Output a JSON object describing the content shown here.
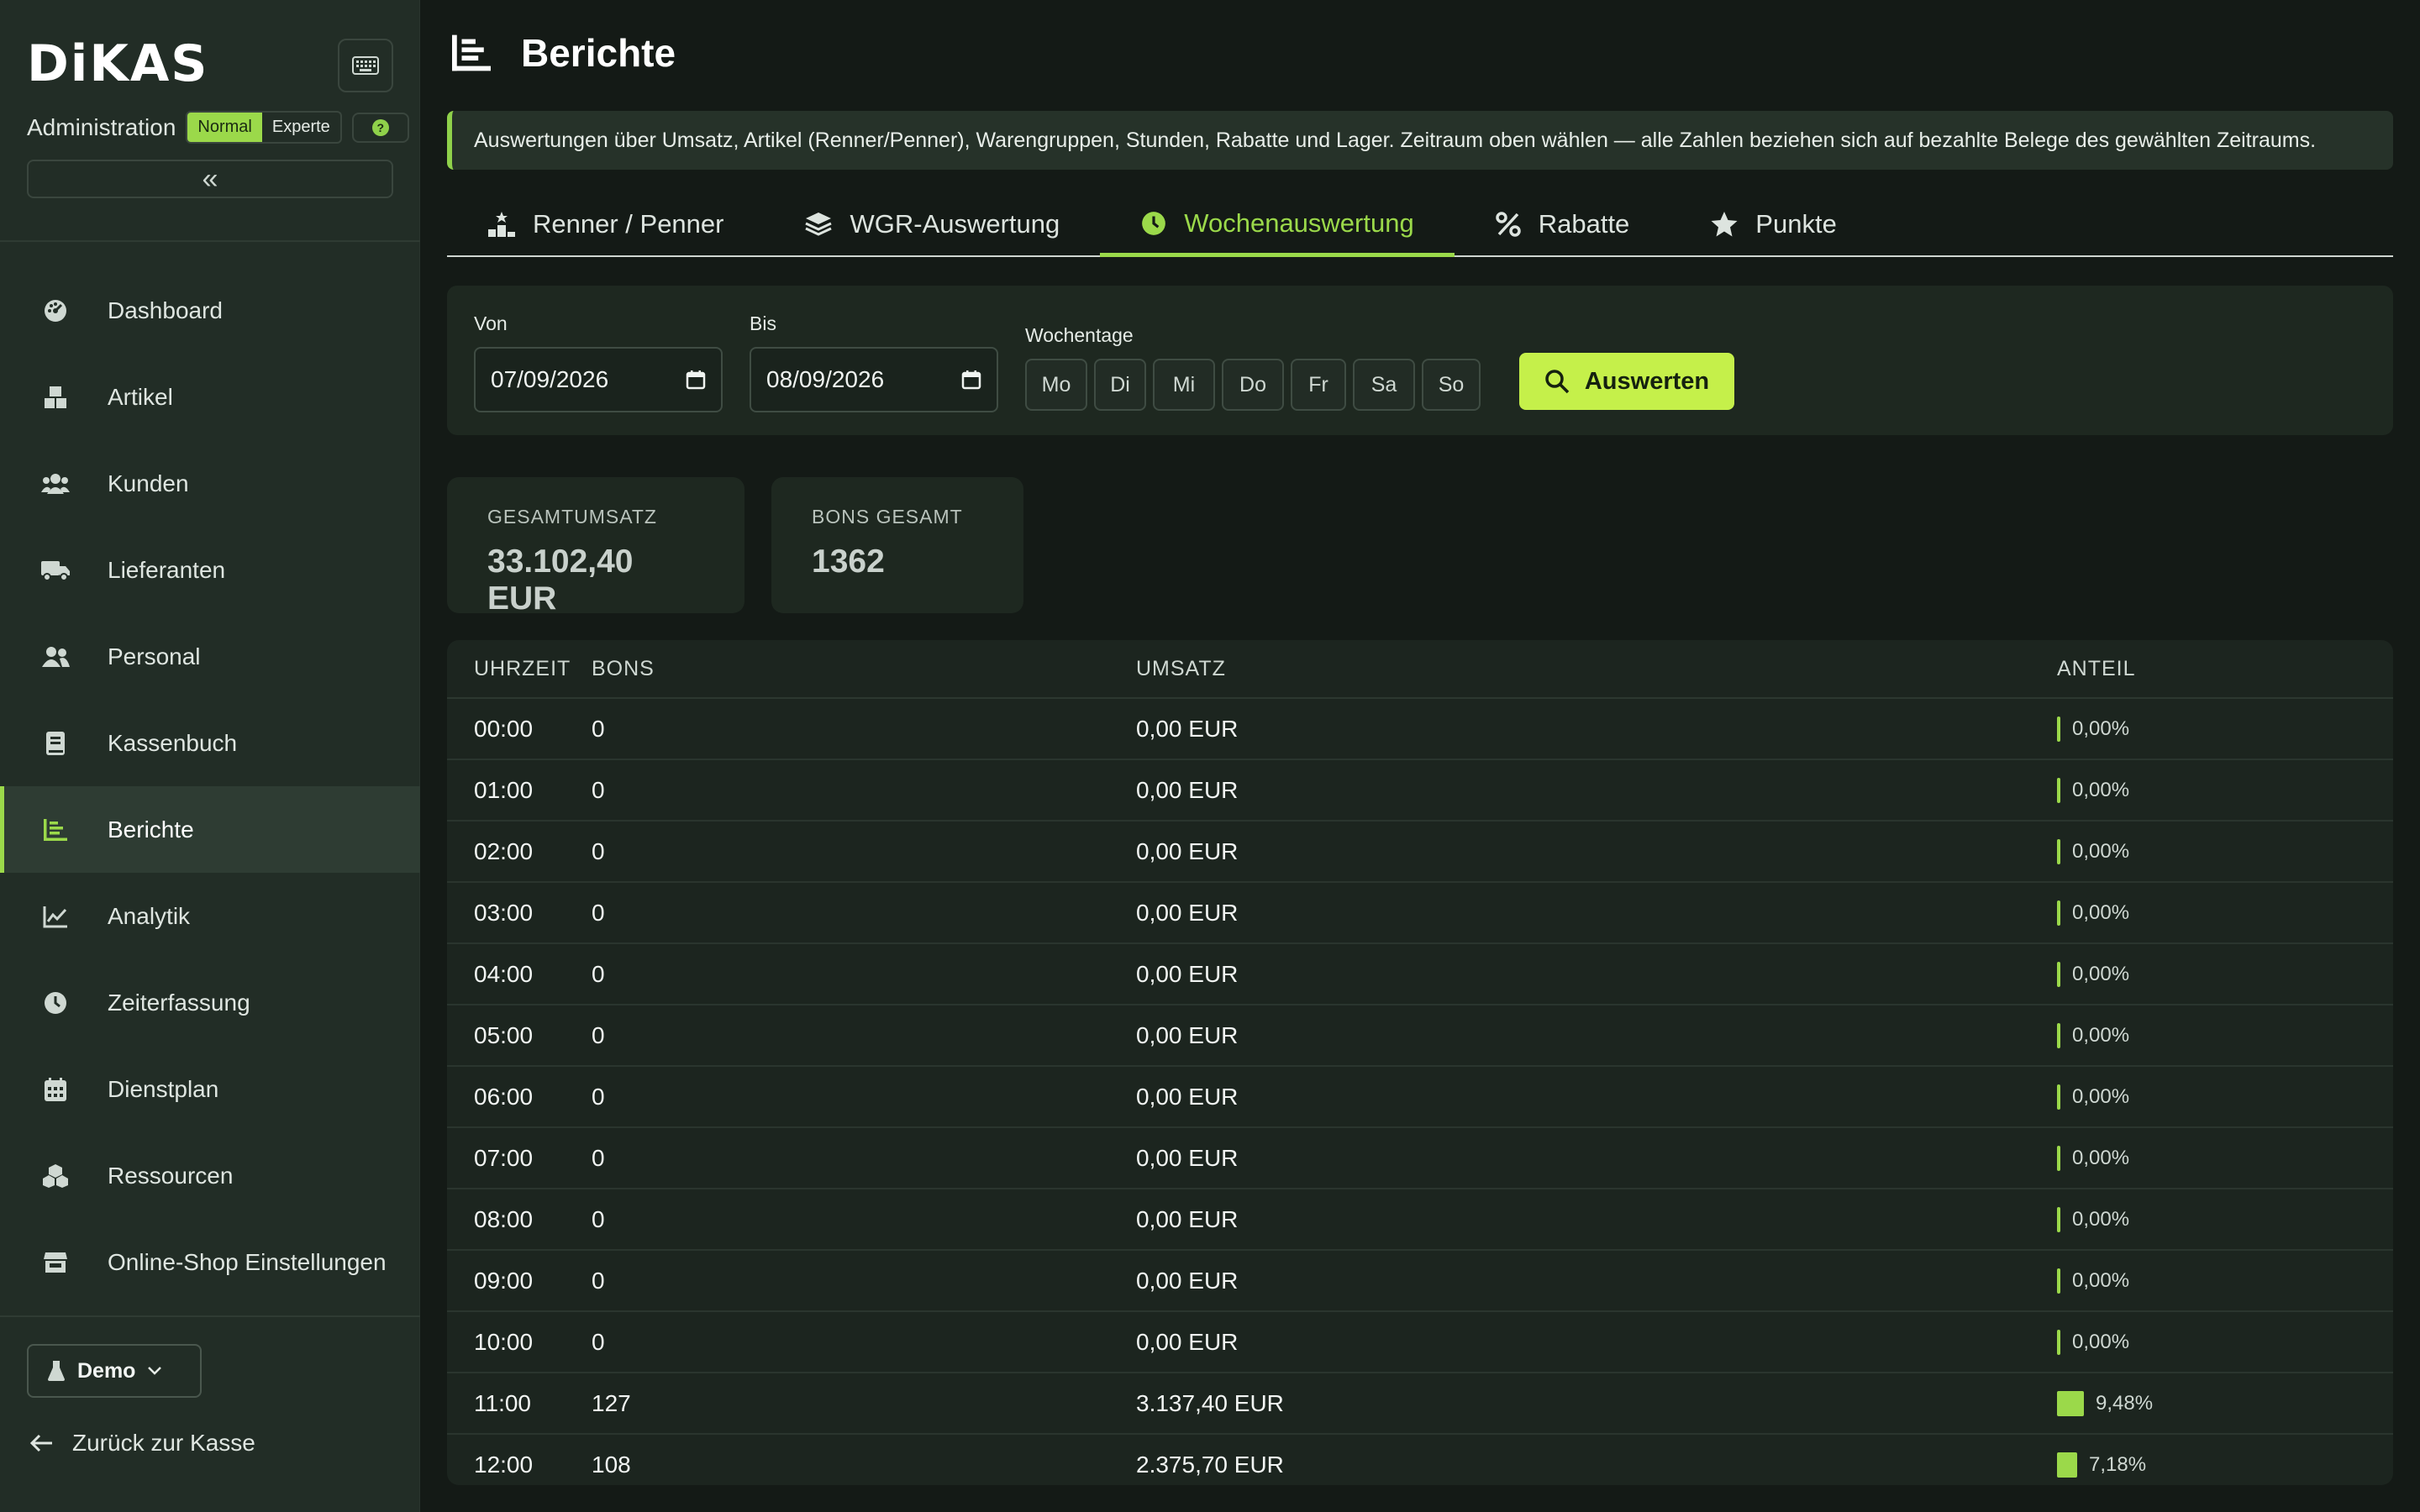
{
  "app": {
    "logo": "DiKAS",
    "admin_label": "Administration",
    "mode_normal": "Normal",
    "mode_expert": "Experte",
    "help": "?",
    "collapse": "«"
  },
  "nav": [
    {
      "label": "Dashboard",
      "icon": "dashboard-icon"
    },
    {
      "label": "Artikel",
      "icon": "boxes-icon"
    },
    {
      "label": "Kunden",
      "icon": "users-icon"
    },
    {
      "label": "Lieferanten",
      "icon": "truck-icon"
    },
    {
      "label": "Personal",
      "icon": "user-group-icon"
    },
    {
      "label": "Kassenbuch",
      "icon": "book-icon"
    },
    {
      "label": "Berichte",
      "icon": "report-icon",
      "active": true
    },
    {
      "label": "Analytik",
      "icon": "chart-line-icon"
    },
    {
      "label": "Zeiterfassung",
      "icon": "clock-icon"
    },
    {
      "label": "Dienstplan",
      "icon": "calendar-icon"
    },
    {
      "label": "Ressourcen",
      "icon": "cubes-icon"
    },
    {
      "label": "Online-Shop Einstellungen",
      "icon": "store-icon"
    }
  ],
  "footer": {
    "demo_label": "Demo",
    "back_label": "Zurück zur Kasse"
  },
  "page": {
    "title": "Berichte",
    "banner": "Auswertungen über Umsatz, Artikel (Renner/Penner), Warengruppen, Stunden, Rabatte und Lager. Zeitraum oben wählen — alle Zahlen beziehen sich auf bezahlte Belege des gewählten Zeitraums."
  },
  "tabs": [
    {
      "label": "Renner / Penner",
      "icon": "ranking-icon"
    },
    {
      "label": "WGR-Auswertung",
      "icon": "layers-icon"
    },
    {
      "label": "Wochenauswertung",
      "icon": "clock-icon",
      "active": true
    },
    {
      "label": "Rabatte",
      "icon": "percent-icon"
    },
    {
      "label": "Punkte",
      "icon": "star-icon"
    }
  ],
  "filter": {
    "from_label": "Von",
    "from_value": "07/09/2026",
    "to_label": "Bis",
    "to_value": "08/09/2026",
    "weekdays_label": "Wochentage",
    "weekdays": [
      "Mo",
      "Di",
      "Mi",
      "Do",
      "Fr",
      "Sa",
      "So"
    ],
    "submit": "Auswerten"
  },
  "kpis": {
    "revenue_label": "GESAMTUMSATZ",
    "revenue_value": "33.102,40 EUR",
    "bons_label": "BONS GESAMT",
    "bons_value": "1362"
  },
  "table": {
    "headers": [
      "UHRZEIT",
      "BONS",
      "UMSATZ",
      "ANTEIL"
    ],
    "rows": [
      {
        "time": "00:00",
        "bons": "0",
        "revenue": "0,00 EUR",
        "share": "0,00%",
        "share_value": 0
      },
      {
        "time": "01:00",
        "bons": "0",
        "revenue": "0,00 EUR",
        "share": "0,00%",
        "share_value": 0
      },
      {
        "time": "02:00",
        "bons": "0",
        "revenue": "0,00 EUR",
        "share": "0,00%",
        "share_value": 0
      },
      {
        "time": "03:00",
        "bons": "0",
        "revenue": "0,00 EUR",
        "share": "0,00%",
        "share_value": 0
      },
      {
        "time": "04:00",
        "bons": "0",
        "revenue": "0,00 EUR",
        "share": "0,00%",
        "share_value": 0
      },
      {
        "time": "05:00",
        "bons": "0",
        "revenue": "0,00 EUR",
        "share": "0,00%",
        "share_value": 0
      },
      {
        "time": "06:00",
        "bons": "0",
        "revenue": "0,00 EUR",
        "share": "0,00%",
        "share_value": 0
      },
      {
        "time": "07:00",
        "bons": "0",
        "revenue": "0,00 EUR",
        "share": "0,00%",
        "share_value": 0
      },
      {
        "time": "08:00",
        "bons": "0",
        "revenue": "0,00 EUR",
        "share": "0,00%",
        "share_value": 0
      },
      {
        "time": "09:00",
        "bons": "0",
        "revenue": "0,00 EUR",
        "share": "0,00%",
        "share_value": 0
      },
      {
        "time": "10:00",
        "bons": "0",
        "revenue": "0,00 EUR",
        "share": "0,00%",
        "share_value": 0
      },
      {
        "time": "11:00",
        "bons": "127",
        "revenue": "3.137,40 EUR",
        "share": "9,48%",
        "share_value": 9.48
      },
      {
        "time": "12:00",
        "bons": "108",
        "revenue": "2.375,70 EUR",
        "share": "7,18%",
        "share_value": 7.18
      }
    ]
  },
  "colors": {
    "accent": "#9bd94a",
    "button": "#c5f04a",
    "sidebar": "#222d26",
    "background": "#141a16"
  }
}
